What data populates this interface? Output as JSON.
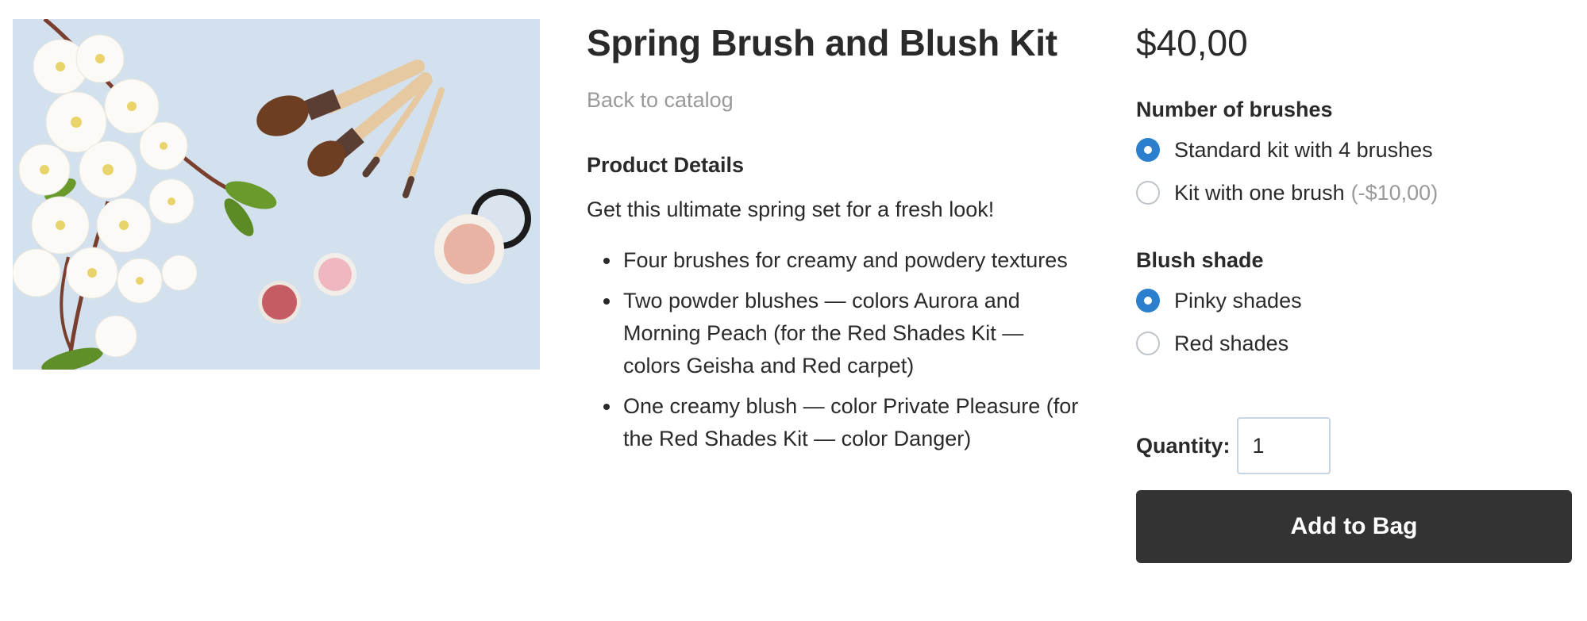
{
  "product": {
    "title": "Spring Brush and Blush Kit",
    "back_link": "Back to catalog",
    "details_heading": "Product Details",
    "intro": "Get this ultimate spring set for a fresh look!",
    "bullets": [
      "Four brushes for creamy and powdery textures",
      "Two powder blushes — colors Aurora and Morning Peach (for the Red Shades Kit — colors Geisha and Red carpet)",
      "One creamy blush — color Private Pleasure (for the Red Shades Kit — color Danger)"
    ]
  },
  "purchase": {
    "price": "$40,00",
    "brushes": {
      "heading": "Number of brushes",
      "options": [
        {
          "label": "Standard kit with 4 brushes",
          "note": "",
          "selected": true
        },
        {
          "label": "Kit with one brush",
          "note": "(-$10,00)",
          "selected": false
        }
      ]
    },
    "shade": {
      "heading": "Blush shade",
      "options": [
        {
          "label": "Pinky shades",
          "selected": true
        },
        {
          "label": "Red shades",
          "selected": false
        }
      ]
    },
    "quantity_label": "Quantity:",
    "quantity_value": "1",
    "add_button": "Add to Bag"
  },
  "colors": {
    "accent": "#2b7fcd",
    "button_bg": "#333333",
    "muted_text": "#9a9a9a",
    "image_bg": "#d6e3ef"
  }
}
